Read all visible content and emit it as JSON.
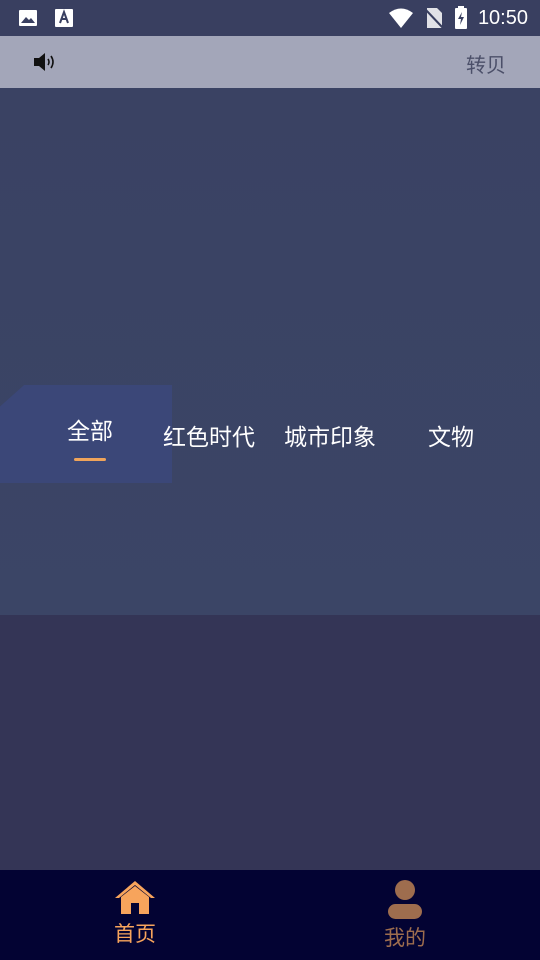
{
  "status_bar": {
    "time": "10:50",
    "icons": [
      "image-icon",
      "font-icon",
      "wifi-icon",
      "no-sim-icon",
      "battery-icon"
    ]
  },
  "toolbar": {
    "sound_icon": "speaker-icon",
    "right_text": "转贝"
  },
  "categories": {
    "tabs": [
      {
        "label": "全部",
        "selected": true
      },
      {
        "label": "红色时代",
        "selected": false
      },
      {
        "label": "城市印象",
        "selected": false
      },
      {
        "label": "文物",
        "selected": false
      }
    ]
  },
  "bottom_nav": {
    "items": [
      {
        "label": "首页",
        "icon": "home-icon",
        "active": true
      },
      {
        "label": "我的",
        "icon": "user-icon",
        "active": false
      }
    ]
  },
  "colors": {
    "accent": "#f7a45c",
    "nav_background": "#030333",
    "toolbar_background": "#a3a6b9"
  }
}
